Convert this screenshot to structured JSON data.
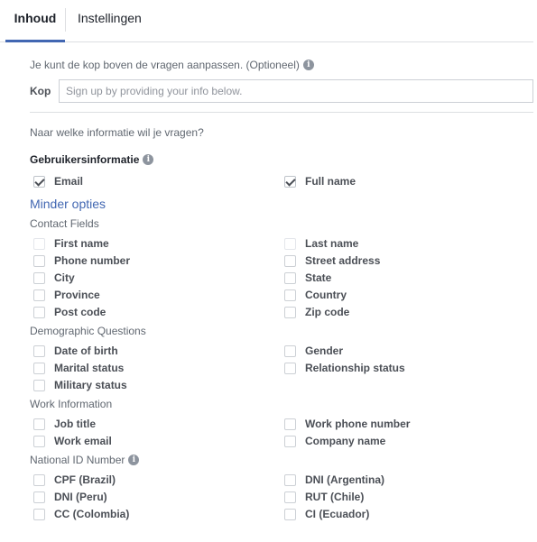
{
  "tabs": {
    "active": "Inhoud",
    "inactive": "Instellingen"
  },
  "header": {
    "hint": "Je kunt de kop boven de vragen aanpassen. (Optioneel)",
    "kop_label": "Kop",
    "kop_placeholder": "Sign up by providing your info below."
  },
  "question": "Naar welke informatie wil je vragen?",
  "user_info": {
    "title": "Gebruikersinformatie",
    "items": [
      {
        "label": "Email",
        "checked": true
      },
      {
        "label": "Full name",
        "checked": true
      }
    ]
  },
  "less_options": "Minder opties",
  "groups": [
    {
      "title": "Contact Fields",
      "items": [
        {
          "label": "First name",
          "checked": false
        },
        {
          "label": "Last name",
          "checked": false
        },
        {
          "label": "Phone number",
          "checked": false
        },
        {
          "label": "Street address",
          "checked": false
        },
        {
          "label": "City",
          "checked": false
        },
        {
          "label": "State",
          "checked": false
        },
        {
          "label": "Province",
          "checked": false
        },
        {
          "label": "Country",
          "checked": false
        },
        {
          "label": "Post code",
          "checked": false
        },
        {
          "label": "Zip code",
          "checked": false
        }
      ]
    },
    {
      "title": "Demographic Questions",
      "items": [
        {
          "label": "Date of birth",
          "checked": false
        },
        {
          "label": "Gender",
          "checked": false
        },
        {
          "label": "Marital status",
          "checked": false
        },
        {
          "label": "Relationship status",
          "checked": false
        },
        {
          "label": "Military status",
          "checked": false
        }
      ]
    },
    {
      "title": "Work Information",
      "items": [
        {
          "label": "Job title",
          "checked": false
        },
        {
          "label": "Work phone number",
          "checked": false
        },
        {
          "label": "Work email",
          "checked": false
        },
        {
          "label": "Company name",
          "checked": false
        }
      ]
    },
    {
      "title": "National ID Number",
      "items": [
        {
          "label": "CPF (Brazil)",
          "checked": false
        },
        {
          "label": "DNI (Argentina)",
          "checked": false
        },
        {
          "label": "DNI (Peru)",
          "checked": false
        },
        {
          "label": "RUT (Chile)",
          "checked": false
        },
        {
          "label": "CC (Colombia)",
          "checked": false
        },
        {
          "label": "CI (Ecuador)",
          "checked": false
        }
      ]
    }
  ],
  "colors": {
    "accent": "#4267b2",
    "muted_text": "#606770",
    "border": "#dddfe2"
  }
}
